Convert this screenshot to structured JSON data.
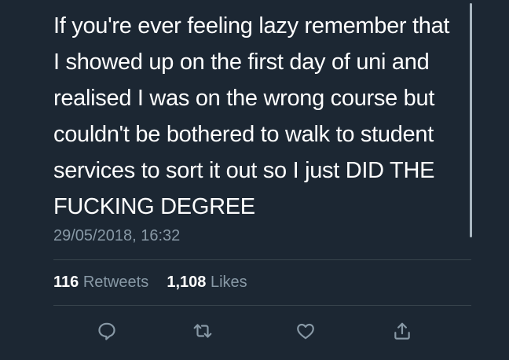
{
  "tweet": {
    "lines": [
      "If you're ever feeling lazy remember that",
      "I showed up on the first day of uni and",
      "realised I was on the wrong course but",
      "couldn't be bothered to walk to student",
      "services to sort it out so I just DID THE",
      "FUCKING DEGREE"
    ],
    "timestamp": "29/05/2018, 16:32"
  },
  "stats": {
    "retweets_count": "116",
    "retweets_label": "Retweets",
    "likes_count": "1,108",
    "likes_label": "Likes"
  },
  "actions": {
    "icons": [
      "reply-icon",
      "retweet-icon",
      "like-icon",
      "share-icon"
    ]
  },
  "colors": {
    "background": "#1c2733",
    "text": "#ffffff",
    "secondary_text": "#8899a6",
    "divider": "#38444d"
  }
}
